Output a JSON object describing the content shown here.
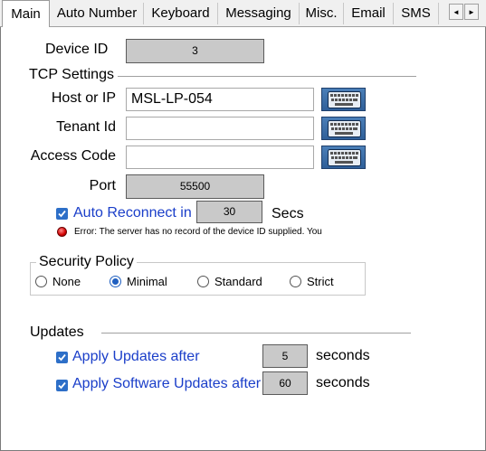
{
  "tabs": [
    {
      "label": "Main",
      "active": true
    },
    {
      "label": "Auto Number"
    },
    {
      "label": "Keyboard"
    },
    {
      "label": "Messaging"
    },
    {
      "label": "Misc."
    },
    {
      "label": "Email"
    },
    {
      "label": "SMS"
    }
  ],
  "tab_scroll": {
    "left_glyph": "◄",
    "right_glyph": "►"
  },
  "device": {
    "label": "Device ID",
    "value": "3"
  },
  "tcp": {
    "section_title": "TCP Settings",
    "host_label": "Host or IP",
    "host_value": "MSL-LP-054",
    "tenant_label": "Tenant Id",
    "tenant_value": "",
    "access_label": "Access Code",
    "access_value": "",
    "port_label": "Port",
    "port_value": "55500",
    "keyboard_icon": "keyboard-icon",
    "auto_reconnect": {
      "label": "Auto Reconnect in",
      "checked": true,
      "value": "30",
      "unit": "Secs"
    },
    "error_text": "Error: The server has no record of the device ID supplied. You"
  },
  "security": {
    "title": "Security Policy",
    "options": [
      {
        "label": "None",
        "selected": false
      },
      {
        "label": "Minimal",
        "selected": true
      },
      {
        "label": "Standard",
        "selected": false
      },
      {
        "label": "Strict",
        "selected": false
      }
    ]
  },
  "updates": {
    "title": "Updates",
    "apply_updates": {
      "label": "Apply Updates after",
      "checked": true,
      "value": "5",
      "unit": "seconds"
    },
    "apply_software": {
      "label": "Apply Software Updates after",
      "checked": true,
      "value": "60",
      "unit": "seconds"
    }
  },
  "colors": {
    "accent": "#2d6fc8",
    "link_text": "#1a3ec9",
    "readonly_bg": "#c9c9c9",
    "error": "#d30000"
  }
}
